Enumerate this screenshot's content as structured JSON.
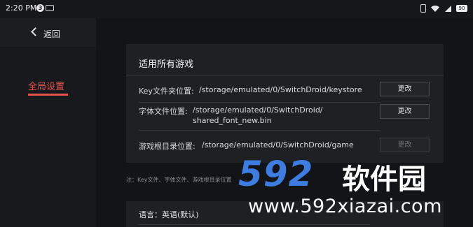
{
  "status_bar": {
    "time": "2:20 PM",
    "notification_count": "3",
    "battery": "90"
  },
  "sidebar": {
    "back_label": "返回",
    "items": [
      {
        "label": "全局设置",
        "active": true
      }
    ]
  },
  "section": {
    "title": "适用所有游戏",
    "rows": [
      {
        "label": "Key文件夹位置:",
        "value": "/storage/emulated/0/SwitchDroid/keystore",
        "button": "更改",
        "enabled": true
      },
      {
        "label": "字体文件位置:",
        "value": "/storage/emulated/0/SwitchDroid/ shared_font_new.bin",
        "button": "更改",
        "enabled": true
      },
      {
        "label": "游戏根目录位置:",
        "value": "/storage/emulated/0/SwitchDroid/game",
        "button": "更改",
        "enabled": false
      }
    ]
  },
  "note": "注：Key文件、字体文件、游戏根目录位置",
  "language": {
    "label": "语言：英语(默认)"
  },
  "watermark": {
    "number": "592",
    "brand": "软件园",
    "url": "www.592xiazai.com"
  },
  "colors": {
    "accent": "#e5534b",
    "watermark_blue": "#3d7ce0",
    "background": "#121418",
    "card": "#1e2024"
  }
}
